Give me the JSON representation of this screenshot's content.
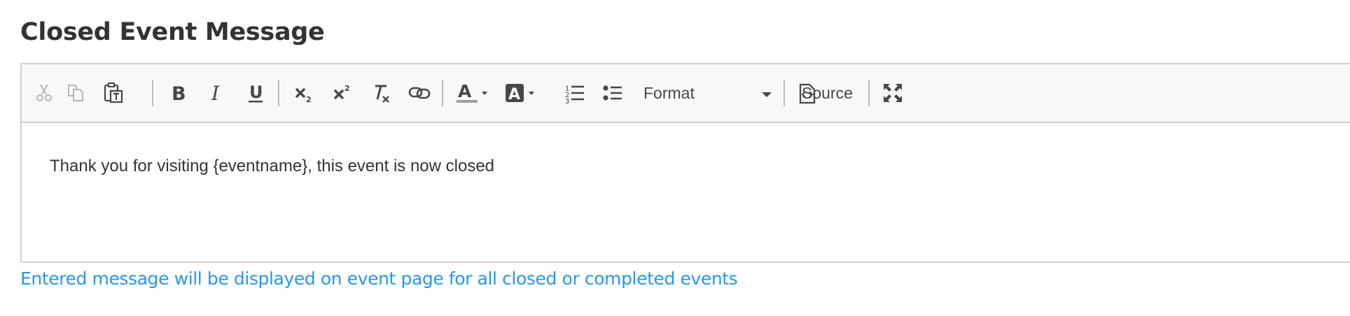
{
  "title": "Closed Event Message",
  "toolbar": {
    "buttons": [
      {
        "name": "cut",
        "icon": "scissors-icon",
        "enabled": false
      },
      {
        "name": "copy",
        "icon": "copy-icon",
        "enabled": false
      },
      {
        "name": "paste-text",
        "icon": "paste-as-text-icon",
        "enabled": true
      },
      {
        "name": "bold",
        "icon": "bold-icon",
        "enabled": true
      },
      {
        "name": "italic",
        "icon": "italic-icon",
        "enabled": true
      },
      {
        "name": "underline",
        "icon": "underline-icon",
        "enabled": true
      },
      {
        "name": "subscript",
        "icon": "subscript-icon",
        "enabled": true
      },
      {
        "name": "superscript",
        "icon": "superscript-icon",
        "enabled": true
      },
      {
        "name": "remove-format",
        "icon": "remove-format-icon",
        "enabled": true
      },
      {
        "name": "link",
        "icon": "link-icon",
        "enabled": true
      },
      {
        "name": "text-color",
        "icon": "text-color-icon",
        "enabled": true
      },
      {
        "name": "background-color",
        "icon": "background-color-icon",
        "enabled": true
      },
      {
        "name": "numbered-list",
        "icon": "numbered-list-icon",
        "enabled": true
      },
      {
        "name": "bulleted-list",
        "icon": "bulleted-list-icon",
        "enabled": true
      },
      {
        "name": "maximize",
        "icon": "maximize-icon",
        "enabled": true
      }
    ],
    "format_label": "Format",
    "source_label": "Source"
  },
  "editor": {
    "content": "Thank you for visiting {eventname}, this event is now closed"
  },
  "help_text": "Entered message will be displayed on event page for all closed or completed events",
  "colors": {
    "title": "#333333",
    "toolbar_bg": "#f8f8f8",
    "border": "#d1d1d1",
    "icon": "#474747",
    "disabled_icon": "#b5b5b5",
    "help_text": "#2996e6"
  }
}
